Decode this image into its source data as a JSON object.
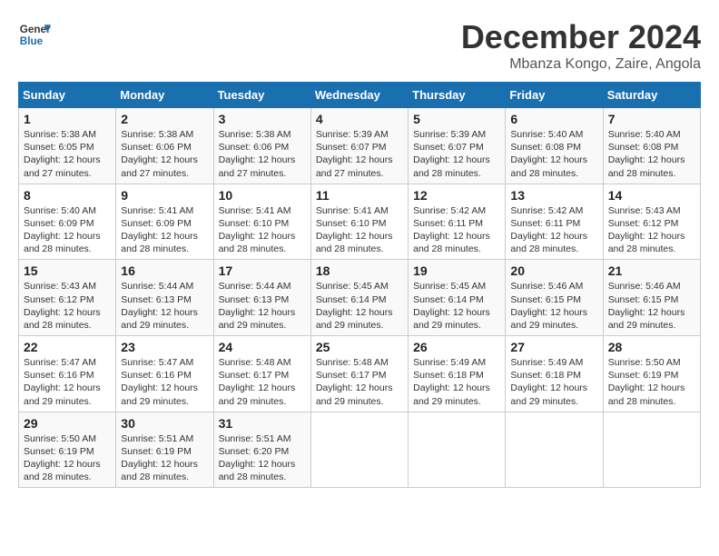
{
  "header": {
    "logo_line1": "General",
    "logo_line2": "Blue",
    "month": "December 2024",
    "location": "Mbanza Kongo, Zaire, Angola"
  },
  "days_of_week": [
    "Sunday",
    "Monday",
    "Tuesday",
    "Wednesday",
    "Thursday",
    "Friday",
    "Saturday"
  ],
  "weeks": [
    [
      {
        "day": "1",
        "info": "Sunrise: 5:38 AM\nSunset: 6:05 PM\nDaylight: 12 hours\nand 27 minutes."
      },
      {
        "day": "2",
        "info": "Sunrise: 5:38 AM\nSunset: 6:06 PM\nDaylight: 12 hours\nand 27 minutes."
      },
      {
        "day": "3",
        "info": "Sunrise: 5:38 AM\nSunset: 6:06 PM\nDaylight: 12 hours\nand 27 minutes."
      },
      {
        "day": "4",
        "info": "Sunrise: 5:39 AM\nSunset: 6:07 PM\nDaylight: 12 hours\nand 27 minutes."
      },
      {
        "day": "5",
        "info": "Sunrise: 5:39 AM\nSunset: 6:07 PM\nDaylight: 12 hours\nand 28 minutes."
      },
      {
        "day": "6",
        "info": "Sunrise: 5:40 AM\nSunset: 6:08 PM\nDaylight: 12 hours\nand 28 minutes."
      },
      {
        "day": "7",
        "info": "Sunrise: 5:40 AM\nSunset: 6:08 PM\nDaylight: 12 hours\nand 28 minutes."
      }
    ],
    [
      {
        "day": "8",
        "info": "Sunrise: 5:40 AM\nSunset: 6:09 PM\nDaylight: 12 hours\nand 28 minutes."
      },
      {
        "day": "9",
        "info": "Sunrise: 5:41 AM\nSunset: 6:09 PM\nDaylight: 12 hours\nand 28 minutes."
      },
      {
        "day": "10",
        "info": "Sunrise: 5:41 AM\nSunset: 6:10 PM\nDaylight: 12 hours\nand 28 minutes."
      },
      {
        "day": "11",
        "info": "Sunrise: 5:41 AM\nSunset: 6:10 PM\nDaylight: 12 hours\nand 28 minutes."
      },
      {
        "day": "12",
        "info": "Sunrise: 5:42 AM\nSunset: 6:11 PM\nDaylight: 12 hours\nand 28 minutes."
      },
      {
        "day": "13",
        "info": "Sunrise: 5:42 AM\nSunset: 6:11 PM\nDaylight: 12 hours\nand 28 minutes."
      },
      {
        "day": "14",
        "info": "Sunrise: 5:43 AM\nSunset: 6:12 PM\nDaylight: 12 hours\nand 28 minutes."
      }
    ],
    [
      {
        "day": "15",
        "info": "Sunrise: 5:43 AM\nSunset: 6:12 PM\nDaylight: 12 hours\nand 28 minutes."
      },
      {
        "day": "16",
        "info": "Sunrise: 5:44 AM\nSunset: 6:13 PM\nDaylight: 12 hours\nand 29 minutes."
      },
      {
        "day": "17",
        "info": "Sunrise: 5:44 AM\nSunset: 6:13 PM\nDaylight: 12 hours\nand 29 minutes."
      },
      {
        "day": "18",
        "info": "Sunrise: 5:45 AM\nSunset: 6:14 PM\nDaylight: 12 hours\nand 29 minutes."
      },
      {
        "day": "19",
        "info": "Sunrise: 5:45 AM\nSunset: 6:14 PM\nDaylight: 12 hours\nand 29 minutes."
      },
      {
        "day": "20",
        "info": "Sunrise: 5:46 AM\nSunset: 6:15 PM\nDaylight: 12 hours\nand 29 minutes."
      },
      {
        "day": "21",
        "info": "Sunrise: 5:46 AM\nSunset: 6:15 PM\nDaylight: 12 hours\nand 29 minutes."
      }
    ],
    [
      {
        "day": "22",
        "info": "Sunrise: 5:47 AM\nSunset: 6:16 PM\nDaylight: 12 hours\nand 29 minutes."
      },
      {
        "day": "23",
        "info": "Sunrise: 5:47 AM\nSunset: 6:16 PM\nDaylight: 12 hours\nand 29 minutes."
      },
      {
        "day": "24",
        "info": "Sunrise: 5:48 AM\nSunset: 6:17 PM\nDaylight: 12 hours\nand 29 minutes."
      },
      {
        "day": "25",
        "info": "Sunrise: 5:48 AM\nSunset: 6:17 PM\nDaylight: 12 hours\nand 29 minutes."
      },
      {
        "day": "26",
        "info": "Sunrise: 5:49 AM\nSunset: 6:18 PM\nDaylight: 12 hours\nand 29 minutes."
      },
      {
        "day": "27",
        "info": "Sunrise: 5:49 AM\nSunset: 6:18 PM\nDaylight: 12 hours\nand 29 minutes."
      },
      {
        "day": "28",
        "info": "Sunrise: 5:50 AM\nSunset: 6:19 PM\nDaylight: 12 hours\nand 28 minutes."
      }
    ],
    [
      {
        "day": "29",
        "info": "Sunrise: 5:50 AM\nSunset: 6:19 PM\nDaylight: 12 hours\nand 28 minutes."
      },
      {
        "day": "30",
        "info": "Sunrise: 5:51 AM\nSunset: 6:19 PM\nDaylight: 12 hours\nand 28 minutes."
      },
      {
        "day": "31",
        "info": "Sunrise: 5:51 AM\nSunset: 6:20 PM\nDaylight: 12 hours\nand 28 minutes."
      },
      {
        "day": "",
        "info": ""
      },
      {
        "day": "",
        "info": ""
      },
      {
        "day": "",
        "info": ""
      },
      {
        "day": "",
        "info": ""
      }
    ]
  ]
}
